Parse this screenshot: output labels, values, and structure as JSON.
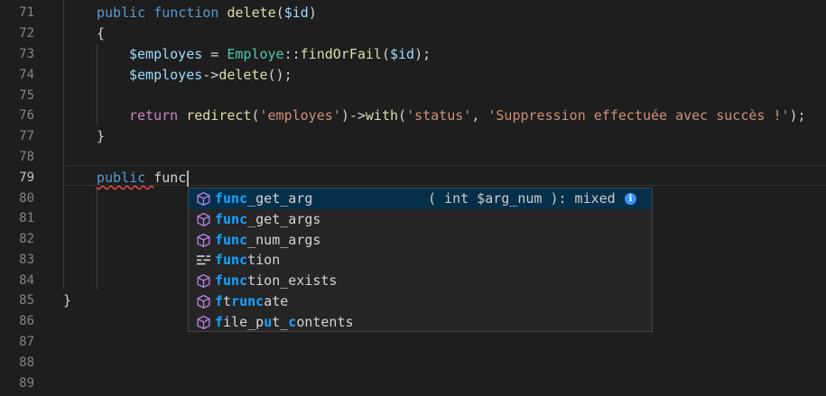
{
  "editor": {
    "line_numbers": [
      "71",
      "72",
      "73",
      "74",
      "75",
      "76",
      "77",
      "78",
      "79",
      "80",
      "81",
      "82",
      "83",
      "84",
      "85",
      "86",
      "87",
      "88",
      "89"
    ],
    "active_line": "79",
    "code": {
      "l71": {
        "kw_public": "public",
        "kw_function": "function",
        "fn_delete": "delete",
        "p_open": "(",
        "var_id": "$id",
        "p_close": ")"
      },
      "l72": {
        "brace": "{"
      },
      "l73": {
        "var_employes": "$employes",
        "eq": " = ",
        "cls_employe": "Employe",
        "dcolon": "::",
        "fn_find": "findOrFail",
        "p_open": "(",
        "var_id": "$id",
        "p_close": ");"
      },
      "l74": {
        "var_employes": "$employes",
        "arrow": "->",
        "fn_delete": "delete",
        "p_rest": "();"
      },
      "l76": {
        "kw_return": "return",
        "fn_redirect": "redirect",
        "p1": "(",
        "str_employes": "'employes'",
        "p2": ")->",
        "fn_with": "with",
        "p3": "(",
        "str_status": "'status'",
        "comma": ", ",
        "str_msg": "'Suppression effectuée avec succès !'",
        "p4": ");"
      },
      "l77": {
        "brace": "}"
      },
      "l79": {
        "kw_public": "public",
        "typed": "func"
      },
      "l85": {
        "brace": "}"
      }
    }
  },
  "suggest": {
    "items": [
      {
        "icon": "method-cube-icon",
        "match": "func",
        "rest": "_get_arg",
        "detail": "( int $arg_num ): mixed",
        "selected": true
      },
      {
        "icon": "method-cube-icon",
        "match": "func",
        "rest": "_get_args"
      },
      {
        "icon": "method-cube-icon",
        "match": "func",
        "rest": "_num_args"
      },
      {
        "icon": "keyword-snippet-icon",
        "match": "func",
        "rest": "tion"
      },
      {
        "icon": "method-cube-icon",
        "match": "func",
        "rest": "tion_exists"
      },
      {
        "icon": "method-cube-icon",
        "parts": [
          "f",
          "t",
          "run",
          "c",
          "ate"
        ]
      },
      {
        "icon": "method-cube-icon",
        "parts": [
          "f",
          "ile_p",
          "u",
          "t_",
          "c",
          "ontents"
        ]
      }
    ]
  },
  "colors": {
    "background": "#1e1e1e",
    "keyword": "#569cd6",
    "function": "#dcdcaa",
    "variable": "#9cdcfe",
    "class": "#4ec9b0",
    "string": "#ce9178",
    "control": "#c586c0",
    "suggest_highlight": "#18a3ff",
    "suggest_selected_bg": "#062f4a",
    "method_icon": "#b180d7",
    "error_squiggle": "#f14c4c"
  }
}
